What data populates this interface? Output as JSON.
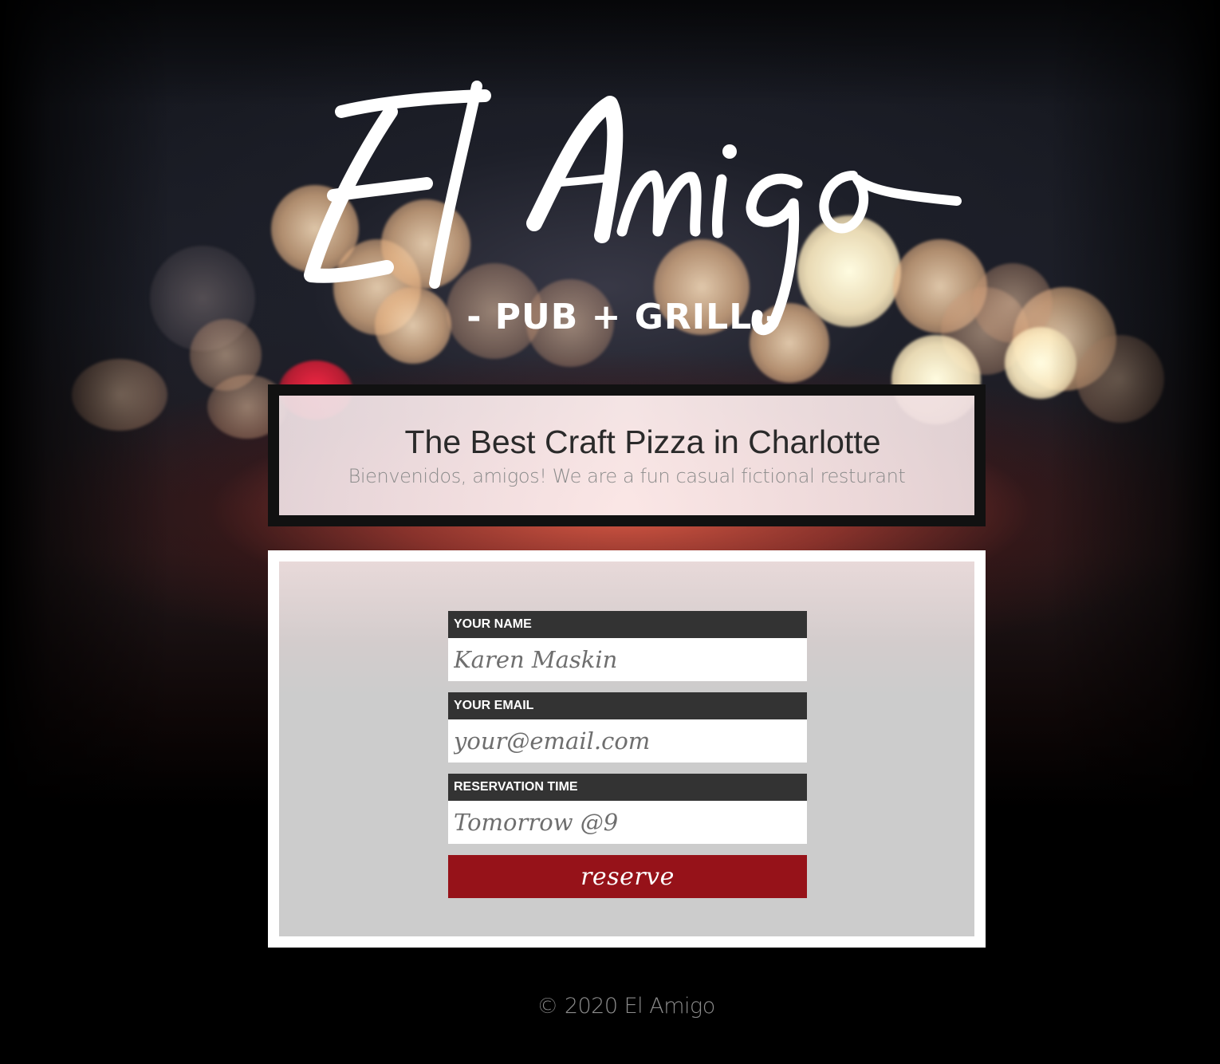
{
  "brand": {
    "logo_main": "El Amigo",
    "logo_sub": "- PUB + GRILL -"
  },
  "hero": {
    "title": "The Best Craft Pizza in Charlotte",
    "subtitle": "Bienvenidos, amigos! We are a fun casual fictional resturant"
  },
  "form": {
    "name": {
      "label": "YOUR NAME",
      "placeholder": "Karen Maskin"
    },
    "email": {
      "label": "YOUR EMAIL",
      "placeholder": "your@email.com"
    },
    "time": {
      "label": "RESERVATION TIME",
      "placeholder": "Tomorrow @9"
    },
    "submit_label": "reserve"
  },
  "footer": {
    "copyright": "© 2020 El Amigo"
  },
  "colors": {
    "button_red": "#961219",
    "label_bg": "#333333",
    "panel_gray": "#cccccc",
    "hero_border": "#111111"
  }
}
